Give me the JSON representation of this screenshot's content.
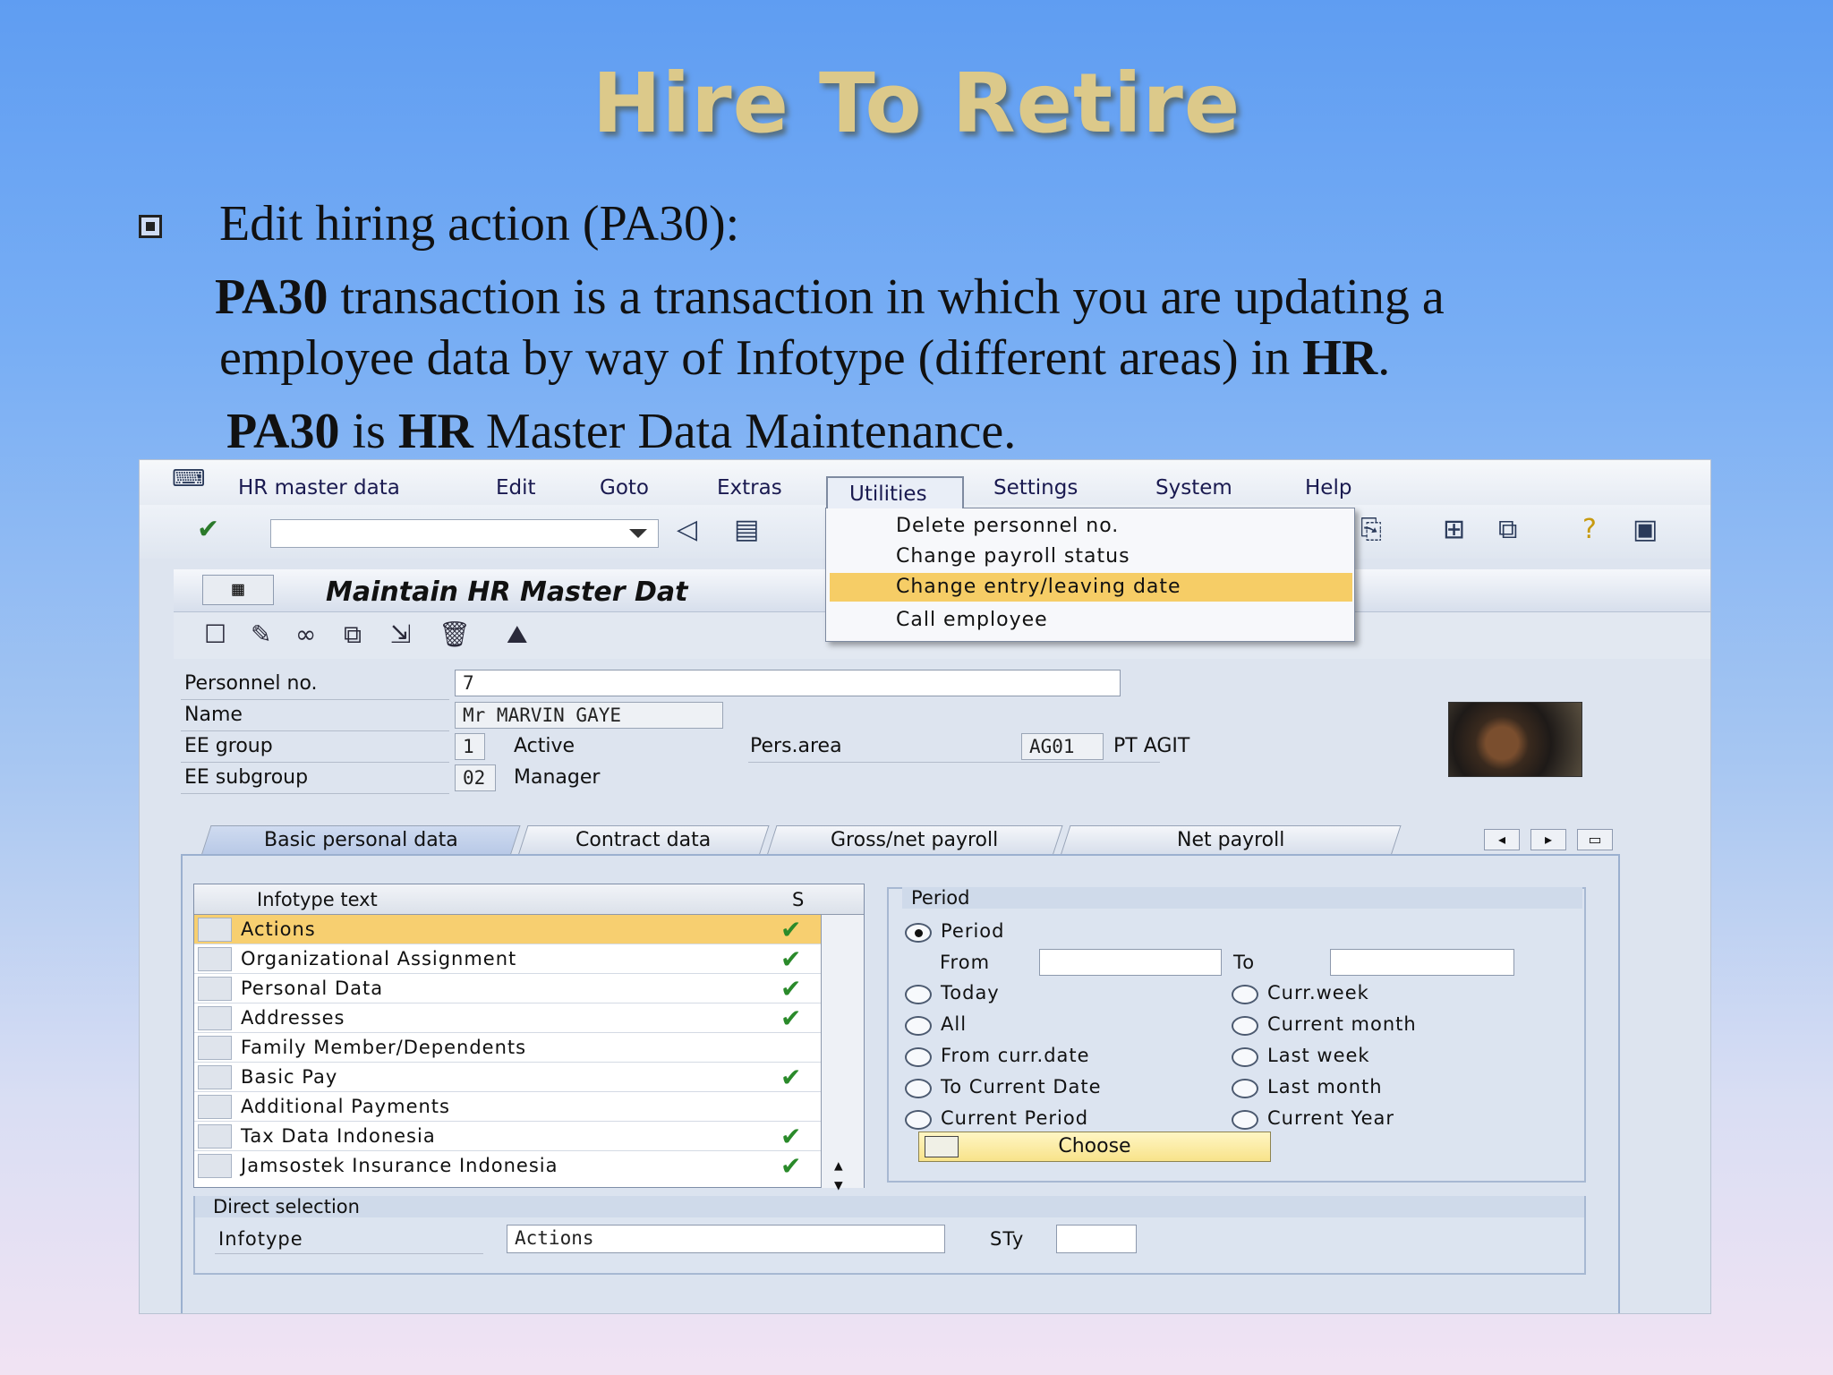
{
  "slide": {
    "title": "Hire To Retire",
    "bullet": "Edit hiring action (PA30):",
    "p1_bold": "PA30",
    "p1_rest": " transaction is a transaction in which you are updating a",
    "p2_rest": "employee data by way of Infotype (different areas) in ",
    "p2_bold": "HR",
    "p2_end": ".",
    "p3_bold1": "PA30",
    "p3_mid": " is ",
    "p3_bold2": "HR",
    "p3_end": " Master Data Maintenance."
  },
  "sap": {
    "menu": [
      "HR master data",
      "Edit",
      "Goto",
      "Extras",
      "Utilities",
      "Settings",
      "System",
      "Help"
    ],
    "screen_title": "Maintain HR Master Dat",
    "utilities_menu": {
      "items": [
        "Delete personnel no.",
        "Change payroll status",
        "Change entry/leaving date",
        "Call employee"
      ],
      "highlighted_index": 2
    },
    "header": {
      "personnel_no_label": "Personnel no.",
      "personnel_no": "7",
      "name_label": "Name",
      "name": "Mr  MARVIN  GAYE",
      "ee_group_label": "EE group",
      "ee_group": "1",
      "ee_group_text": "Active",
      "pers_area_label": "Pers.area",
      "pers_area": "AG01",
      "pers_area_text": "PT AGIT",
      "ee_subgroup_label": "EE subgroup",
      "ee_subgroup": "02",
      "ee_subgroup_text": "Manager"
    },
    "tabs": [
      "Basic personal data",
      "Contract data",
      "Gross/net payroll",
      "Net payroll"
    ],
    "active_tab": "Basic personal data",
    "infotype_grid": {
      "col_text": "Infotype text",
      "col_s": "S",
      "rows": [
        {
          "text": "Actions",
          "checked": true
        },
        {
          "text": "Organizational Assignment",
          "checked": true
        },
        {
          "text": "Personal Data",
          "checked": true
        },
        {
          "text": "Addresses",
          "checked": true
        },
        {
          "text": "Family Member/Dependents",
          "checked": false
        },
        {
          "text": "Basic Pay",
          "checked": true
        },
        {
          "text": "Additional Payments",
          "checked": false
        },
        {
          "text": "Tax Data Indonesia",
          "checked": true
        },
        {
          "text": "Jamsostek Insurance Indonesia",
          "checked": true
        }
      ]
    },
    "period": {
      "box_title": "Period",
      "period_option": "Period",
      "from_label": "From",
      "to_label": "To",
      "from_value": "",
      "to_value": "",
      "left_options": [
        "Today",
        "All",
        "From curr.date",
        "To Current Date",
        "Current Period"
      ],
      "right_options": [
        "Curr.week",
        "Current month",
        "Last week",
        "Last month",
        "Current Year"
      ],
      "choose_label": "Choose"
    },
    "direct": {
      "box_title": "Direct selection",
      "infotype_label": "Infotype",
      "infotype_value": "Actions",
      "sty_label": "STy",
      "sty_value": ""
    }
  }
}
